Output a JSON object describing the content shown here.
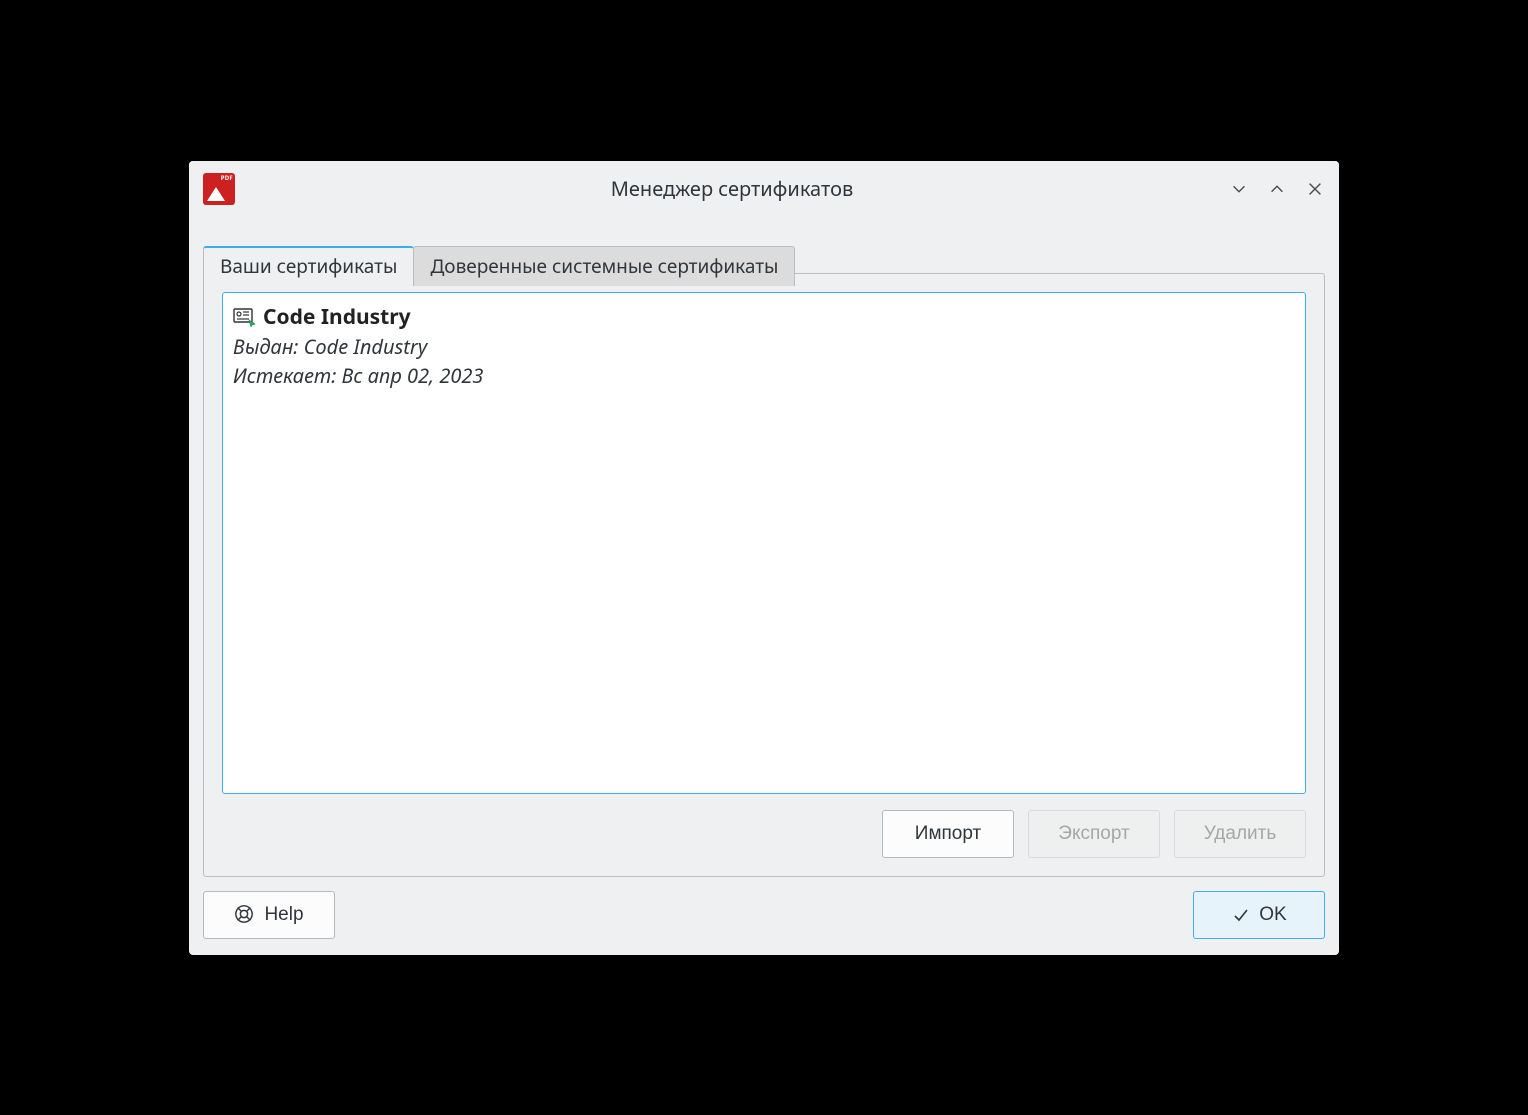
{
  "window": {
    "title": "Менеджер сертификатов"
  },
  "tabs": {
    "your_certs": "Ваши сертификаты",
    "trusted_certs": "Доверенные системные сертификаты"
  },
  "certificate": {
    "name": "Code Industry",
    "issued_by_label": "Выдан:",
    "issued_by_value": "Code Industry",
    "expires_label": "Истекает:",
    "expires_value": "Вс апр 02, 2023"
  },
  "buttons": {
    "import": "Импорт",
    "export": "Экспорт",
    "delete": "Удалить",
    "help": "Help",
    "ok": "OK"
  }
}
